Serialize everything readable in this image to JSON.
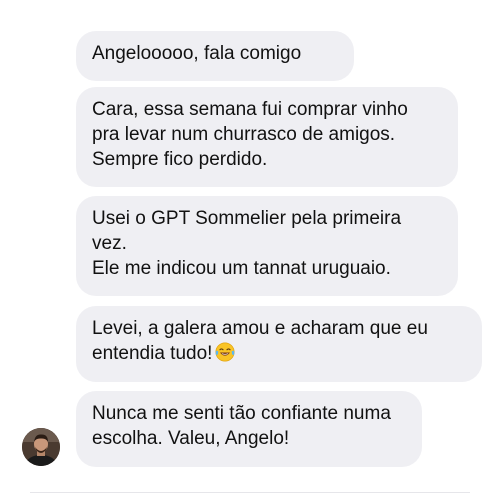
{
  "conversation": {
    "messages": [
      {
        "lines": [
          "Angelooooo, fala comigo"
        ]
      },
      {
        "lines": [
          "Cara, essa semana fui comprar vinho",
          "pra levar num churrasco de amigos.",
          "Sempre fico perdido."
        ]
      },
      {
        "lines": [
          "Usei o GPT Sommelier pela primeira",
          "vez.",
          "Ele me indicou um tannat uruguaio."
        ]
      },
      {
        "lines": [
          "Levei, a galera amou e acharam que eu",
          "entendia tudo!"
        ],
        "emoji": "laughing-tears-emoji"
      },
      {
        "lines": [
          "Nunca me senti tão confiante numa",
          "escolha. Valeu, Angelo!"
        ]
      }
    ]
  },
  "colors": {
    "bubble_background": "#efeff3",
    "text": "#111111"
  }
}
